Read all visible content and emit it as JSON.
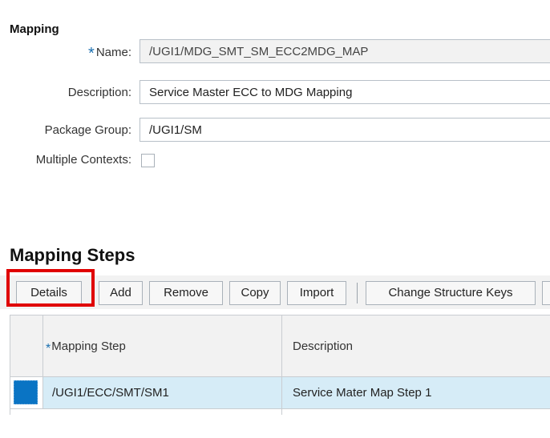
{
  "mapping": {
    "section_title": "Mapping",
    "name_label": "Name:",
    "name_value": "/UGI1/MDG_SMT_SM_ECC2MDG_MAP",
    "description_label": "Description:",
    "description_value": "Service Master ECC to MDG Mapping",
    "package_group_label": "Package Group:",
    "package_group_value": "/UGI1/SM",
    "multiple_contexts_label": "Multiple Contexts:",
    "multiple_contexts_checked": false
  },
  "steps": {
    "title": "Mapping Steps",
    "toolbar": {
      "details": "Details",
      "add": "Add",
      "remove": "Remove",
      "copy": "Copy",
      "import": "Import",
      "change_structure_keys": "Change Structure Keys"
    },
    "columns": {
      "mapping_step": "Mapping Step",
      "description": "Description"
    },
    "rows": [
      {
        "mapping_step": "/UGI1/ECC/SMT/SM1",
        "description": "Service Mater Map Step 1",
        "selected": true
      }
    ]
  },
  "colors": {
    "required_marker": "#1a6fb0",
    "highlight_border": "#e00000",
    "selected_row": "#d6ecf7",
    "row_selector": "#0a74c4"
  }
}
